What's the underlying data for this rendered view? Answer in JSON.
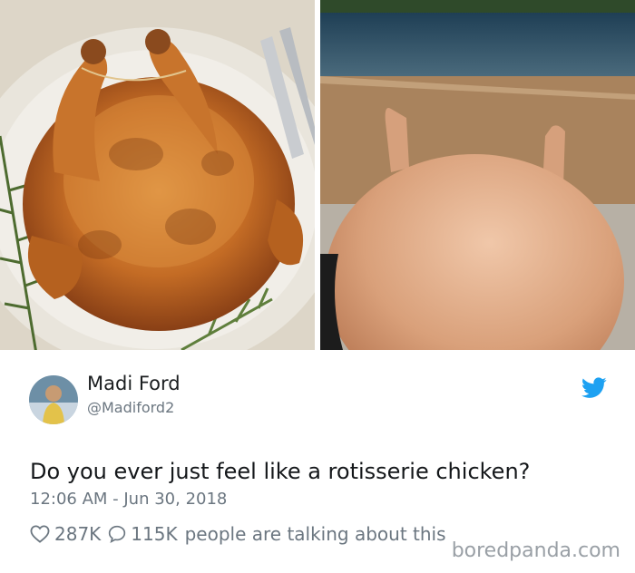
{
  "tweet": {
    "name": "Madi Ford",
    "handle": "@Madiford2",
    "text": "Do you ever just feel like a rotisserie chicken?",
    "timestamp": "12:06 AM - Jun 30, 2018",
    "likes": "287K",
    "replies": "115K",
    "talking": "people are talking about this",
    "icons": {
      "like": "heart-icon",
      "reply": "speech-bubble-icon",
      "brand": "twitter-bird-icon"
    },
    "colors": {
      "brand": "#1da1f2",
      "secondary_text": "#6b7680"
    }
  },
  "watermark": "boredpanda.com"
}
